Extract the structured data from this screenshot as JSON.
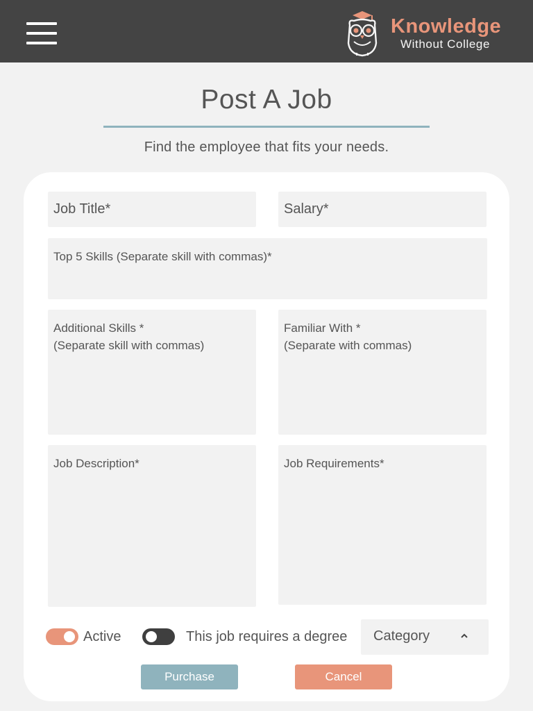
{
  "header": {
    "logo_title": "Knowledge",
    "logo_subtitle": "Without College"
  },
  "page": {
    "title": "Post A Job",
    "subtitle": "Find the employee that fits your needs."
  },
  "form": {
    "job_title": {
      "placeholder": "Job Title*",
      "value": ""
    },
    "salary": {
      "placeholder": "Salary*",
      "value": ""
    },
    "top_skills": {
      "placeholder": "Top 5 Skills (Separate skill with commas)*",
      "value": ""
    },
    "additional_skills": {
      "placeholder": "Additional Skills *\n(Separate skill with commas)",
      "value": ""
    },
    "familiar_with": {
      "placeholder": "Familiar With *\n(Separate with commas)",
      "value": ""
    },
    "job_description": {
      "placeholder": "Job Description*",
      "value": ""
    },
    "job_requirements": {
      "placeholder": "Job Requirements*",
      "value": ""
    },
    "active_toggle": {
      "label": "Active",
      "checked": true
    },
    "degree_toggle": {
      "label": "This job requires a degree",
      "checked": false
    },
    "category": {
      "label": "Category"
    },
    "purchase_label": "Purchase",
    "cancel_label": "Cancel"
  },
  "colors": {
    "header_bg": "#444444",
    "accent_orange": "#e8957a",
    "accent_blue": "#8fb3bd",
    "field_bg": "#f2f2f2"
  },
  "icons": [
    "hamburger-menu-icon",
    "owl-logo-icon",
    "chevron-up-icon"
  ]
}
